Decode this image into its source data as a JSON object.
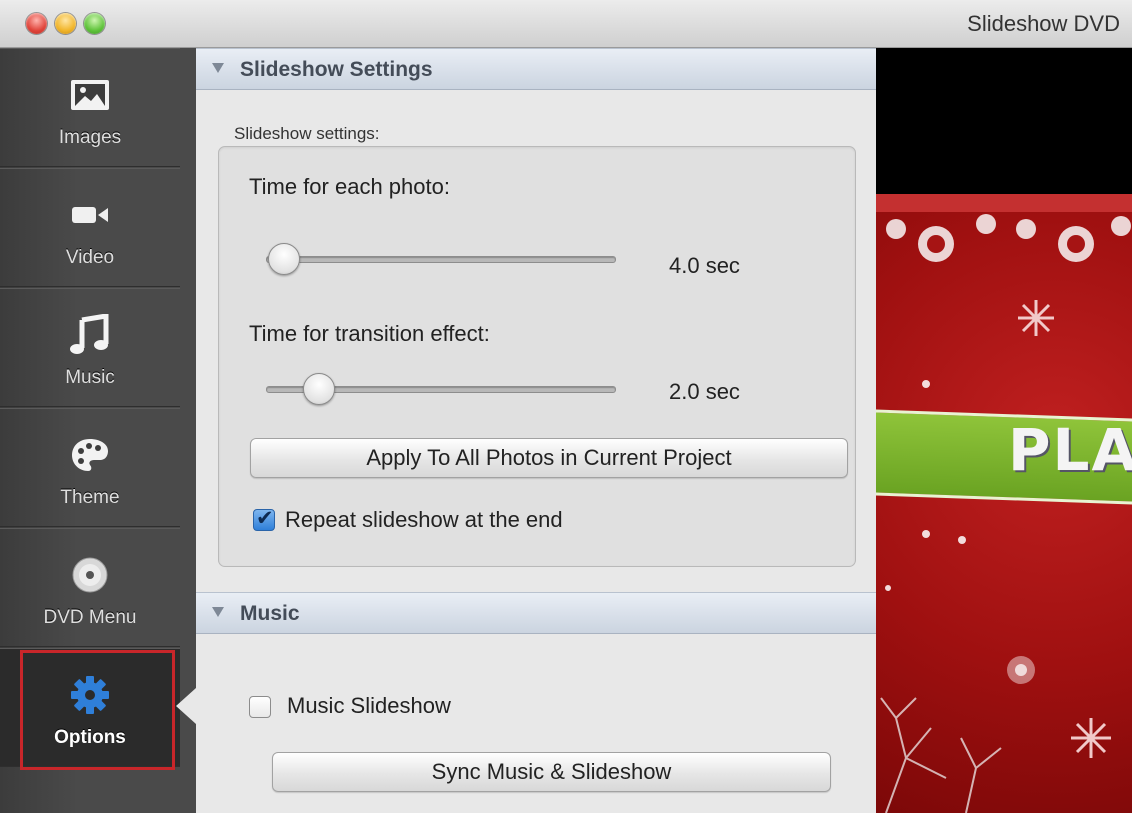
{
  "window": {
    "title": "Slideshow DVD"
  },
  "sidebar": {
    "items": [
      {
        "label": "Images",
        "icon": "image-icon"
      },
      {
        "label": "Video",
        "icon": "video-camera-icon"
      },
      {
        "label": "Music",
        "icon": "music-note-icon"
      },
      {
        "label": "Theme",
        "icon": "palette-icon"
      },
      {
        "label": "DVD Menu",
        "icon": "disc-icon"
      },
      {
        "label": "Options",
        "icon": "gear-icon",
        "active": true
      }
    ]
  },
  "slideshow_section": {
    "header": "Slideshow Settings",
    "group_caption": "Slideshow settings:",
    "photo_time": {
      "label": "Time for each photo:",
      "value": "4.0 sec",
      "level": 0.05
    },
    "transition_time": {
      "label": "Time for transition effect:",
      "value": "2.0 sec",
      "level": 0.15
    },
    "apply_button": "Apply To All Photos in Current Project",
    "repeat": {
      "label": "Repeat slideshow at the end",
      "checked": true
    }
  },
  "music_section": {
    "header": "Music",
    "music_slideshow": {
      "label": "Music Slideshow",
      "checked": false
    },
    "sync_button": "Sync Music & Slideshow"
  },
  "preview": {
    "play_text": "PLAY"
  },
  "colors": {
    "accent_blue": "#2f7fd9",
    "selection_red": "#c8262a",
    "theme_red": "#a61414",
    "theme_green": "#7ab52e"
  }
}
